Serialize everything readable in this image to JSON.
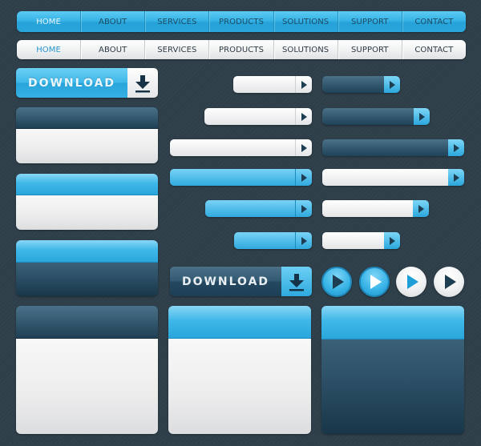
{
  "nav_blue": {
    "items": [
      "HOME",
      "ABOUT",
      "SERVICES",
      "PRODUCTS",
      "SOLUTIONS",
      "SUPPORT",
      "CONTACT"
    ],
    "active": "HOME"
  },
  "nav_white": {
    "items": [
      "HOME",
      "ABOUT",
      "SERVICES",
      "PRODUCTS",
      "SOLUTIONS",
      "SUPPORT",
      "CONTACT"
    ],
    "active": "HOME"
  },
  "download_light": {
    "label": "DOWNLOAD",
    "icon": "download-arrow-icon"
  },
  "download_dark": {
    "label": "DOWNLOAD",
    "icon": "download-arrow-icon"
  },
  "play_buttons": [
    {
      "style": "blue",
      "icon": "play-icon",
      "arrow_color": "#1d3d52"
    },
    {
      "style": "blue",
      "icon": "play-icon",
      "arrow_color": "#ffffff"
    },
    {
      "style": "white",
      "icon": "play-icon",
      "arrow_color": "#1e9fd8"
    },
    {
      "style": "white",
      "icon": "play-icon",
      "arrow_color": "#1d3d52"
    }
  ],
  "colors": {
    "background": "#2e3f4a",
    "accent_blue": "#37b4e6",
    "dark_blue": "#2a4d63",
    "light": "#f0f1f2",
    "text_dark": "#1c4a63"
  }
}
